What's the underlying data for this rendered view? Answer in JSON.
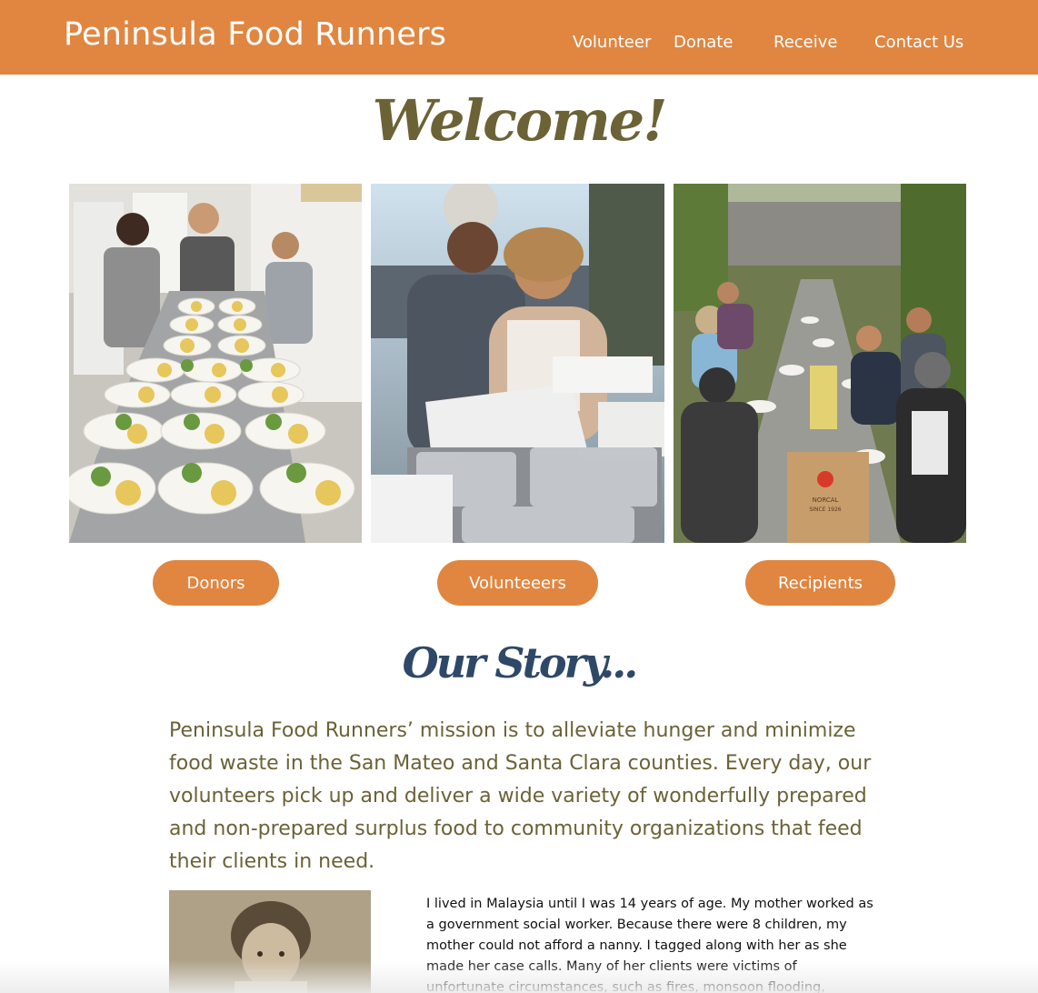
{
  "header": {
    "site_title": "Peninsula Food Runners",
    "nav": [
      "Volunteer",
      "Donate",
      "Receive",
      "Contact Us"
    ]
  },
  "welcome": "Welcome!",
  "buttons": {
    "donors": "Donors",
    "volunteers": "Volunteeers",
    "recipients": "Recipients"
  },
  "story": {
    "title": "Our Story...",
    "mission": "Peninsula Food Runners’ mission is to alleviate hunger and minimize food waste in the San Mateo and Santa Clara counties. Every day, our volunteers pick up and deliver a wide variety of wonderfully prepared and non-prepared surplus food to community organizations that feed their clients in need.",
    "bio": "I lived in Malaysia until I was 14 years of age. My mother worked as a government social worker. Because there were 8 children, my mother could not afford a nanny. I tagged along with her as she made her case calls. Many of her clients were victims of unfortunate circumstances, such as fires, monsoon flooding, homelessness, drug"
  },
  "images": {
    "bag_print_line1": "NORCAL",
    "bag_print_line2": "SINCE 1926"
  },
  "colors": {
    "brand_orange": "#e08641",
    "heading_olive": "#6b6236",
    "heading_navy": "#2e4868"
  }
}
